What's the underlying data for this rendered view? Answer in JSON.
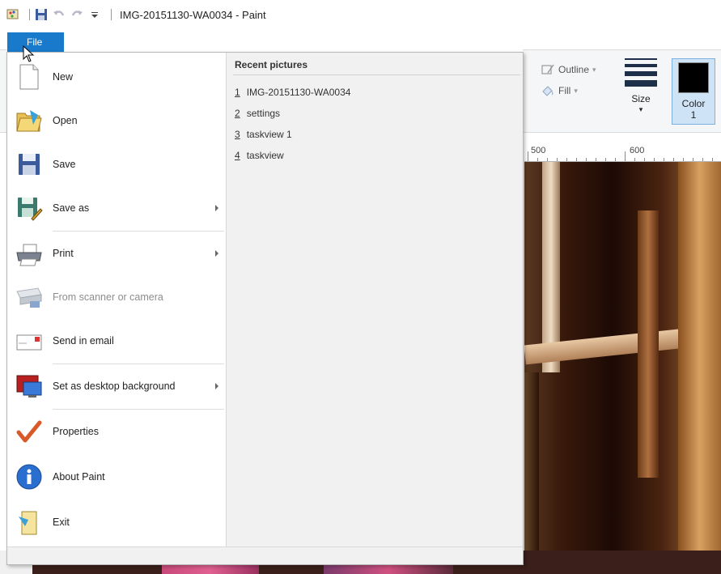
{
  "window": {
    "title": "IMG-20151130-WA0034 - Paint"
  },
  "quick_access": {
    "icons": [
      "paint-app-icon",
      "save-icon",
      "undo-icon",
      "redo-icon",
      "customize-qat-icon"
    ]
  },
  "file_tab": {
    "label": "File"
  },
  "ribbon": {
    "outline_label": "Outline",
    "fill_label": "Fill",
    "size_label": "Size",
    "color_label_line1": "Color",
    "color_label_line2": "1",
    "color1_value": "#000000"
  },
  "ruler": {
    "marks": [
      "500",
      "600"
    ]
  },
  "file_menu": {
    "items": [
      {
        "label": "New",
        "icon": "new-document-icon",
        "submenu": false,
        "disabled": false
      },
      {
        "label": "Open",
        "icon": "open-folder-icon",
        "submenu": false,
        "disabled": false
      },
      {
        "label": "Save",
        "icon": "save-icon",
        "submenu": false,
        "disabled": false
      },
      {
        "label": "Save as",
        "icon": "save-as-icon",
        "submenu": true,
        "disabled": false
      },
      {
        "label": "Print",
        "icon": "printer-icon",
        "submenu": true,
        "disabled": false
      },
      {
        "label": "From scanner or camera",
        "icon": "scanner-icon",
        "submenu": false,
        "disabled": true
      },
      {
        "label": "Send in email",
        "icon": "email-icon",
        "submenu": false,
        "disabled": false
      },
      {
        "label": "Set as desktop background",
        "icon": "desktop-background-icon",
        "submenu": true,
        "disabled": false
      },
      {
        "label": "Properties",
        "icon": "checkmark-icon",
        "submenu": false,
        "disabled": false
      },
      {
        "label": "About Paint",
        "icon": "info-icon",
        "submenu": false,
        "disabled": false
      },
      {
        "label": "Exit",
        "icon": "exit-icon",
        "submenu": false,
        "disabled": false
      }
    ],
    "recent": {
      "title": "Recent pictures",
      "items": [
        {
          "num": "1",
          "name": "IMG-20151130-WA0034"
        },
        {
          "num": "2",
          "name": "settings"
        },
        {
          "num": "3",
          "name": "taskview 1"
        },
        {
          "num": "4",
          "name": "taskview"
        }
      ]
    }
  }
}
